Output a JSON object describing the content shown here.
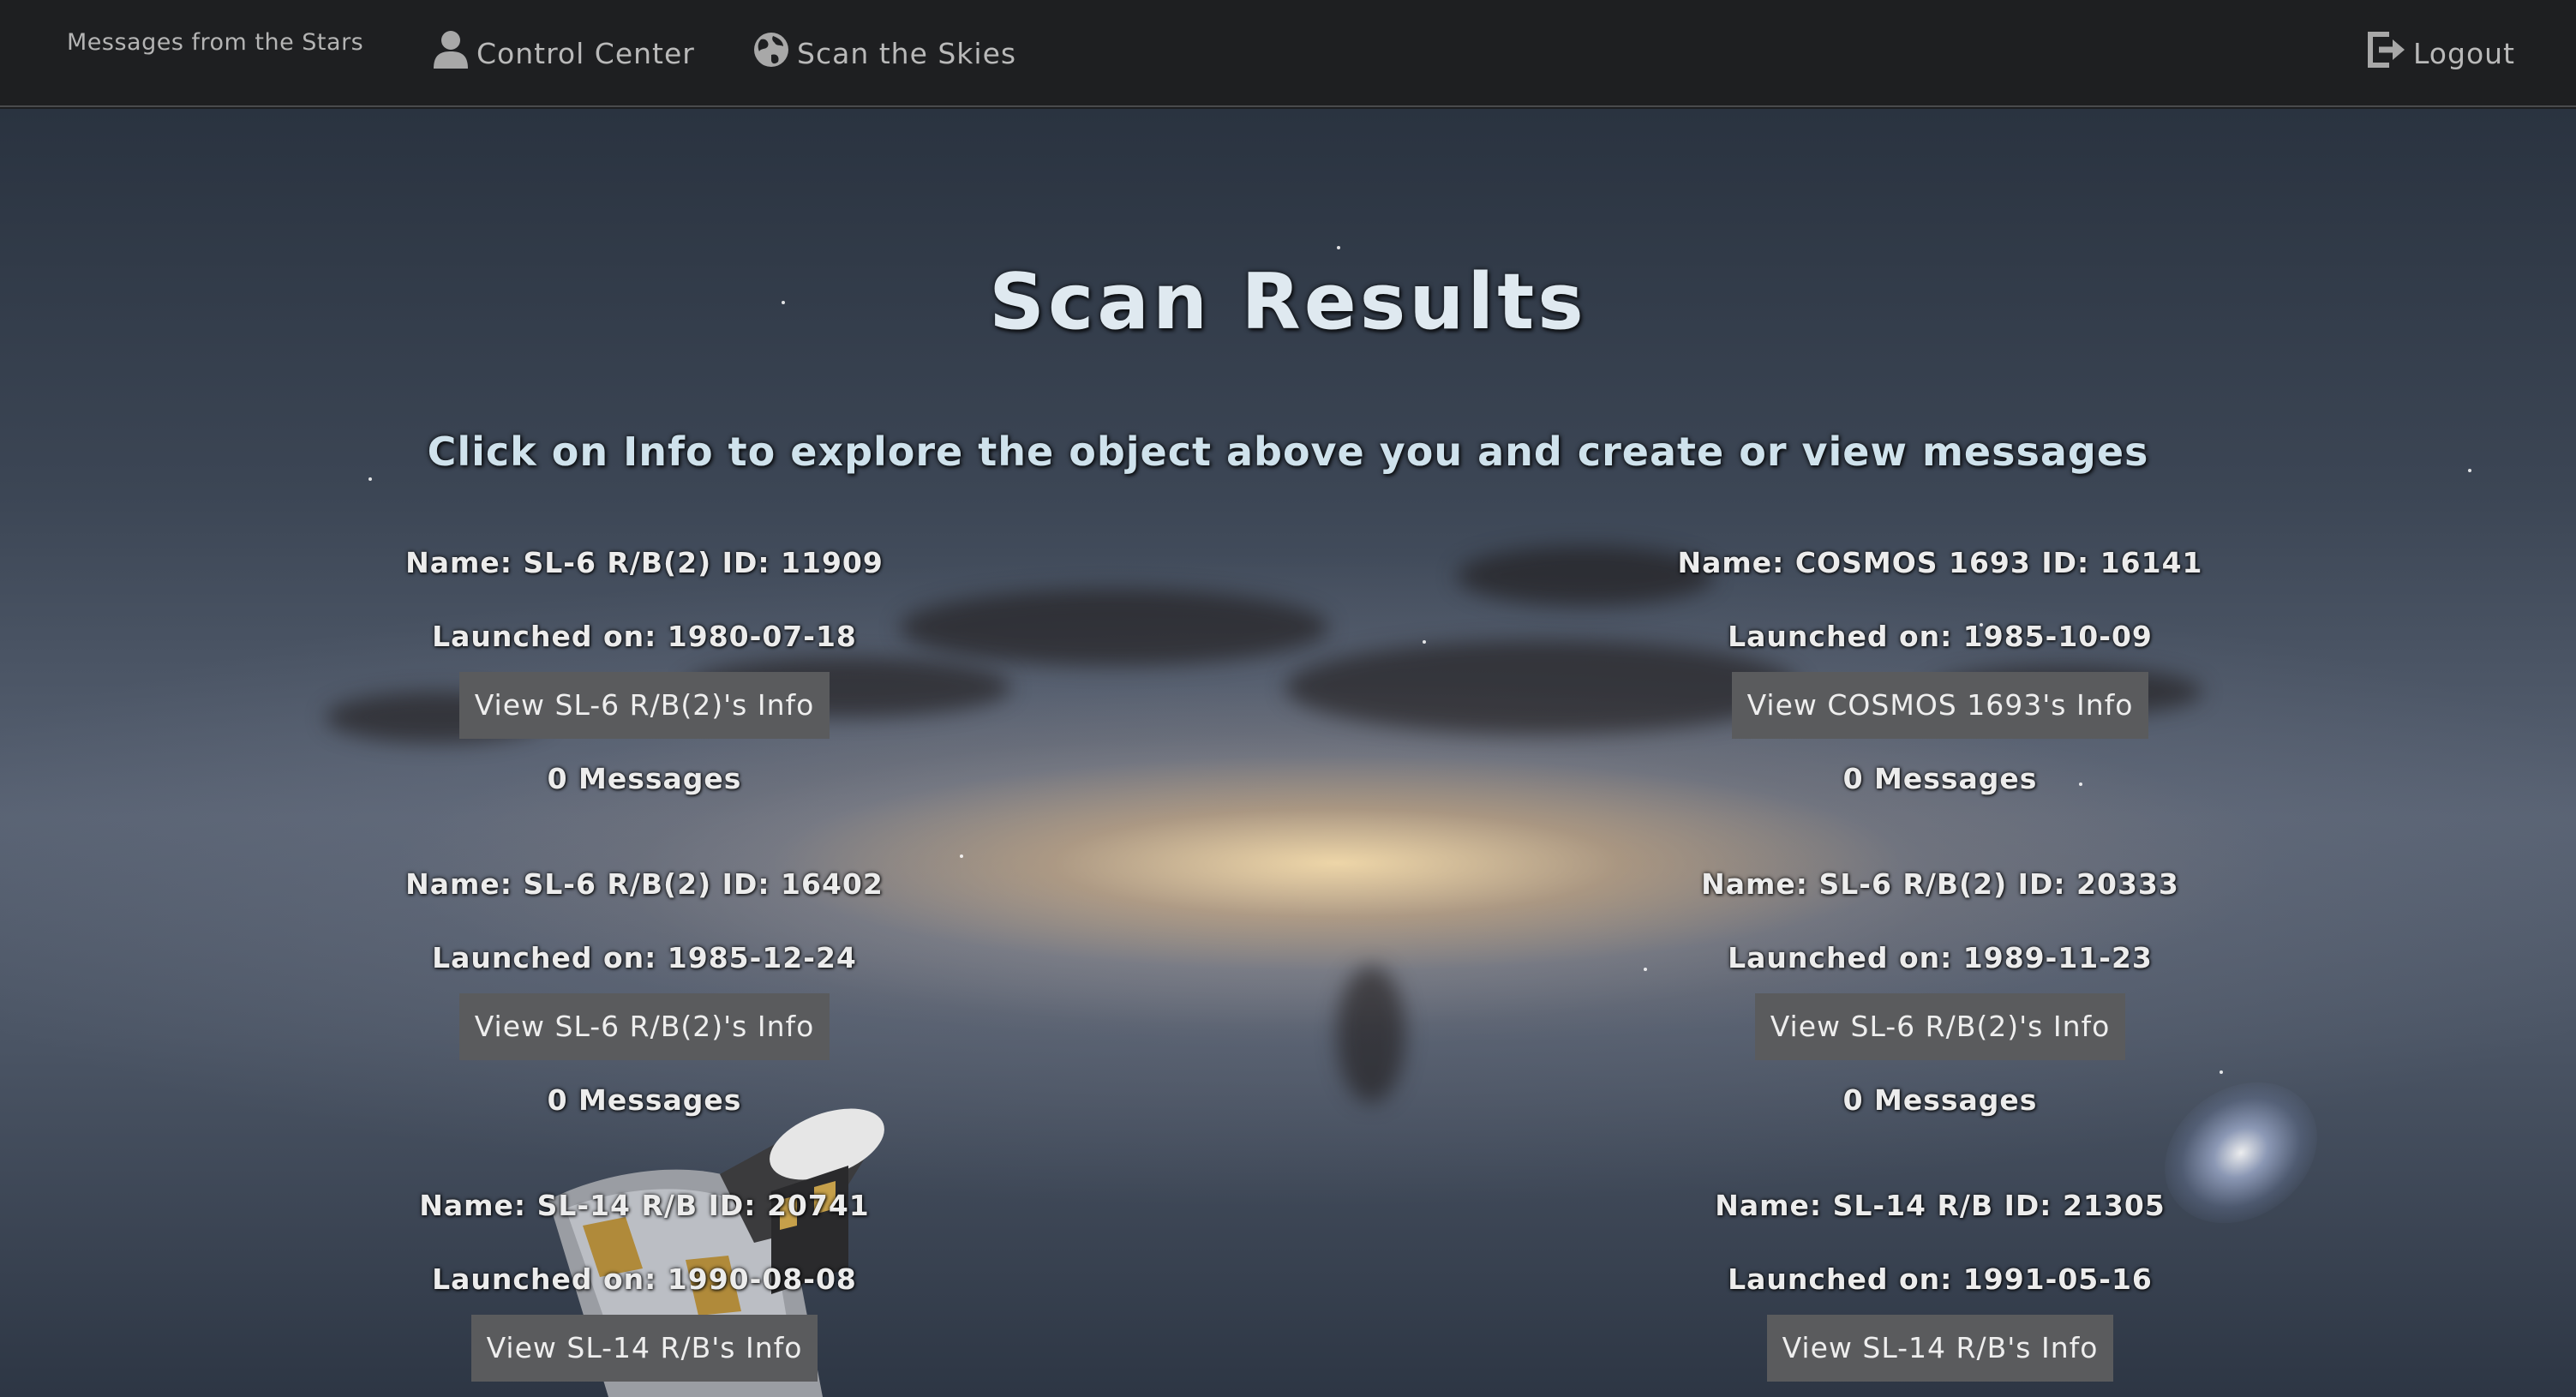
{
  "navbar": {
    "brand": "Messages from the Stars",
    "control_center_label": "Control Center",
    "control_center_icon": "user-icon",
    "scan_label": "Scan the Skies",
    "scan_icon": "globe-icon",
    "logout_label": "Logout",
    "logout_icon": "logout-icon"
  },
  "page": {
    "title": "Scan Results",
    "subtitle": "Click on Info to explore the object above you and create or view messages"
  },
  "results": [
    {
      "name_line": "Name: SL-6 R/B(2) ID: 11909",
      "launch_line": "Launched on: 1980-07-18",
      "button_label": "View SL-6 R/B(2)'s Info",
      "messages_line": "0 Messages"
    },
    {
      "name_line": "Name: COSMOS 1693 ID: 16141",
      "launch_line": "Launched on: 1985-10-09",
      "button_label": "View COSMOS 1693's Info",
      "messages_line": "0 Messages"
    },
    {
      "name_line": "Name: SL-6 R/B(2) ID: 16402",
      "launch_line": "Launched on: 1985-12-24",
      "button_label": "View SL-6 R/B(2)'s Info",
      "messages_line": "0 Messages"
    },
    {
      "name_line": "Name: SL-6 R/B(2) ID: 20333",
      "launch_line": "Launched on: 1989-11-23",
      "button_label": "View SL-6 R/B(2)'s Info",
      "messages_line": "0 Messages"
    },
    {
      "name_line": "Name: SL-14 R/B ID: 20741",
      "launch_line": "Launched on: 1990-08-08",
      "button_label": "View SL-14 R/B's Info",
      "messages_line": ""
    },
    {
      "name_line": "Name: SL-14 R/B ID: 21305",
      "launch_line": "Launched on: 1991-05-16",
      "button_label": "View SL-14 R/B's Info",
      "messages_line": ""
    }
  ],
  "colors": {
    "navbar_bg": "#1e1f21",
    "button_bg": "#5a5b5d",
    "title_text": "#dfe9f0"
  }
}
